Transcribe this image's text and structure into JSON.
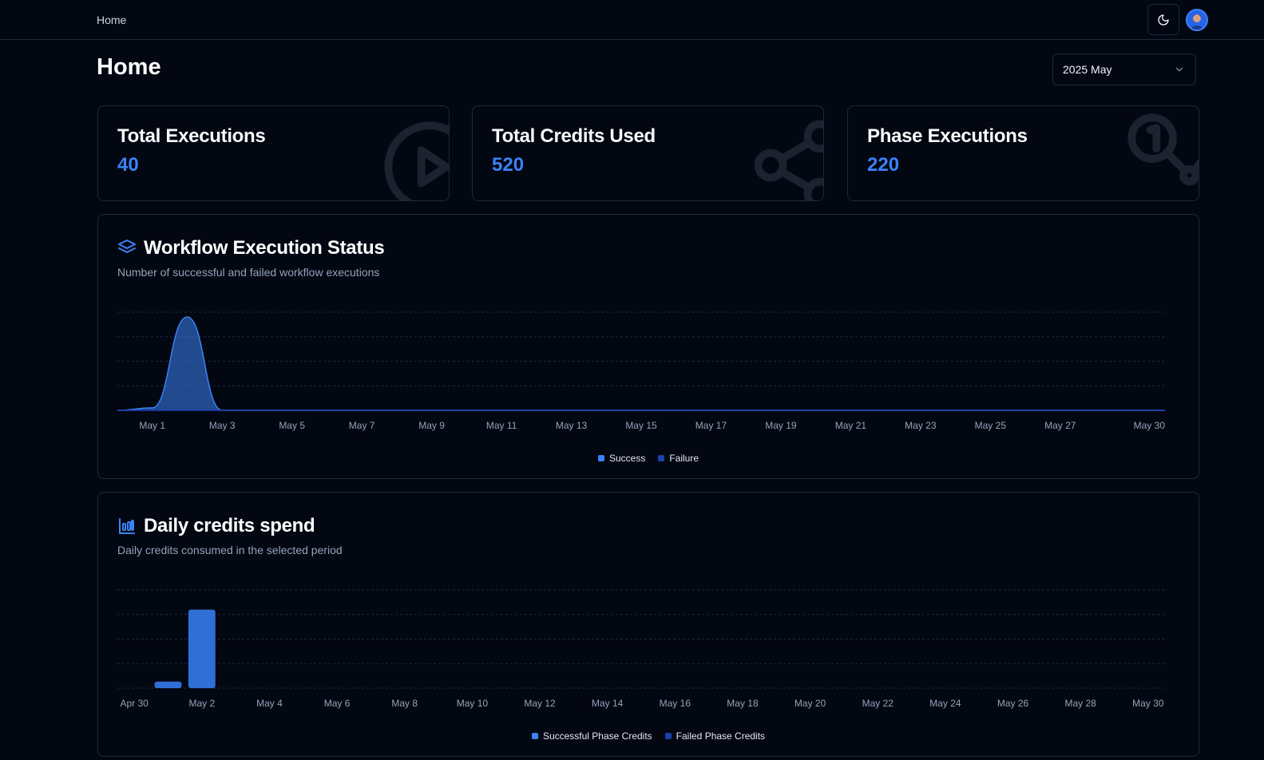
{
  "header": {
    "breadcrumb": "Home",
    "theme_toggle_icon": "moon-icon",
    "avatar_icon": "user-avatar"
  },
  "page": {
    "title": "Home",
    "period_select": "2025 May"
  },
  "stats": [
    {
      "title": "Total Executions",
      "value": "40",
      "icon": "circle-play-icon"
    },
    {
      "title": "Total Credits Used",
      "value": "520",
      "icon": "workflow-icon"
    },
    {
      "title": "Phase Executions",
      "value": "220",
      "icon": "waypoints-icon"
    }
  ],
  "colors": {
    "background": "#030712",
    "border": "#1e293b",
    "accent": "#3b82f6",
    "success": "#3b82f6",
    "failure": "#1e40af"
  },
  "execution_chart": {
    "title": "Workflow Execution Status",
    "subtitle": "Number of successful and failed workflow executions",
    "icon": "layers-icon",
    "legend": [
      "Success",
      "Failure"
    ]
  },
  "credits_chart": {
    "title": "Daily credits spend",
    "subtitle": "Daily credits consumed in the selected period",
    "icon": "bar-chart-icon",
    "legend": [
      "Successful Phase Credits",
      "Failed Phase Credits"
    ]
  },
  "chart_data": [
    {
      "type": "area",
      "title": "Workflow Execution Status",
      "x": [
        "Apr 30",
        "May 1",
        "May 2",
        "May 3",
        "May 4",
        "May 5",
        "May 6",
        "May 7",
        "May 8",
        "May 9",
        "May 10",
        "May 11",
        "May 12",
        "May 13",
        "May 14",
        "May 15",
        "May 16",
        "May 17",
        "May 18",
        "May 19",
        "May 20",
        "May 21",
        "May 22",
        "May 23",
        "May 24",
        "May 25",
        "May 26",
        "May 27",
        "May 28",
        "May 29",
        "May 30"
      ],
      "tick_labels": [
        "May 1",
        "May 3",
        "May 5",
        "May 7",
        "May 9",
        "May 11",
        "May 13",
        "May 15",
        "May 17",
        "May 19",
        "May 21",
        "May 23",
        "May 25",
        "May 27",
        "May 30"
      ],
      "series": [
        {
          "name": "Success",
          "values": [
            0,
            1,
            38,
            0,
            0,
            0,
            0,
            0,
            0,
            0,
            0,
            0,
            0,
            0,
            0,
            0,
            0,
            0,
            0,
            0,
            0,
            0,
            0,
            0,
            0,
            0,
            0,
            0,
            0,
            0,
            0
          ]
        },
        {
          "name": "Failure",
          "values": [
            0,
            0,
            0,
            0,
            0,
            0,
            0,
            0,
            0,
            0,
            0,
            0,
            0,
            0,
            0,
            0,
            0,
            0,
            0,
            0,
            0,
            0,
            0,
            0,
            0,
            0,
            0,
            0,
            0,
            0,
            0
          ]
        }
      ],
      "ylim": [
        0,
        40
      ],
      "grid": true,
      "legend_position": "bottom"
    },
    {
      "type": "bar",
      "title": "Daily credits spend",
      "categories": [
        "Apr 30",
        "May 1",
        "May 2",
        "May 3",
        "May 4",
        "May 5",
        "May 6",
        "May 7",
        "May 8",
        "May 9",
        "May 10",
        "May 11",
        "May 12",
        "May 13",
        "May 14",
        "May 15",
        "May 16",
        "May 17",
        "May 18",
        "May 19",
        "May 20",
        "May 21",
        "May 22",
        "May 23",
        "May 24",
        "May 25",
        "May 26",
        "May 27",
        "May 28",
        "May 29",
        "May 30"
      ],
      "tick_labels": [
        "Apr 30",
        "May 2",
        "May 4",
        "May 6",
        "May 8",
        "May 10",
        "May 12",
        "May 14",
        "May 16",
        "May 18",
        "May 20",
        "May 22",
        "May 24",
        "May 26",
        "May 28",
        "May 30"
      ],
      "series": [
        {
          "name": "Successful Phase Credits",
          "values": [
            0,
            40,
            480,
            0,
            0,
            0,
            0,
            0,
            0,
            0,
            0,
            0,
            0,
            0,
            0,
            0,
            0,
            0,
            0,
            0,
            0,
            0,
            0,
            0,
            0,
            0,
            0,
            0,
            0,
            0,
            0
          ]
        },
        {
          "name": "Failed Phase Credits",
          "values": [
            0,
            0,
            0,
            0,
            0,
            0,
            0,
            0,
            0,
            0,
            0,
            0,
            0,
            0,
            0,
            0,
            0,
            0,
            0,
            0,
            0,
            0,
            0,
            0,
            0,
            0,
            0,
            0,
            0,
            0,
            0
          ]
        }
      ],
      "ylim": [
        0,
        600
      ],
      "grid": true,
      "legend_position": "bottom"
    }
  ]
}
